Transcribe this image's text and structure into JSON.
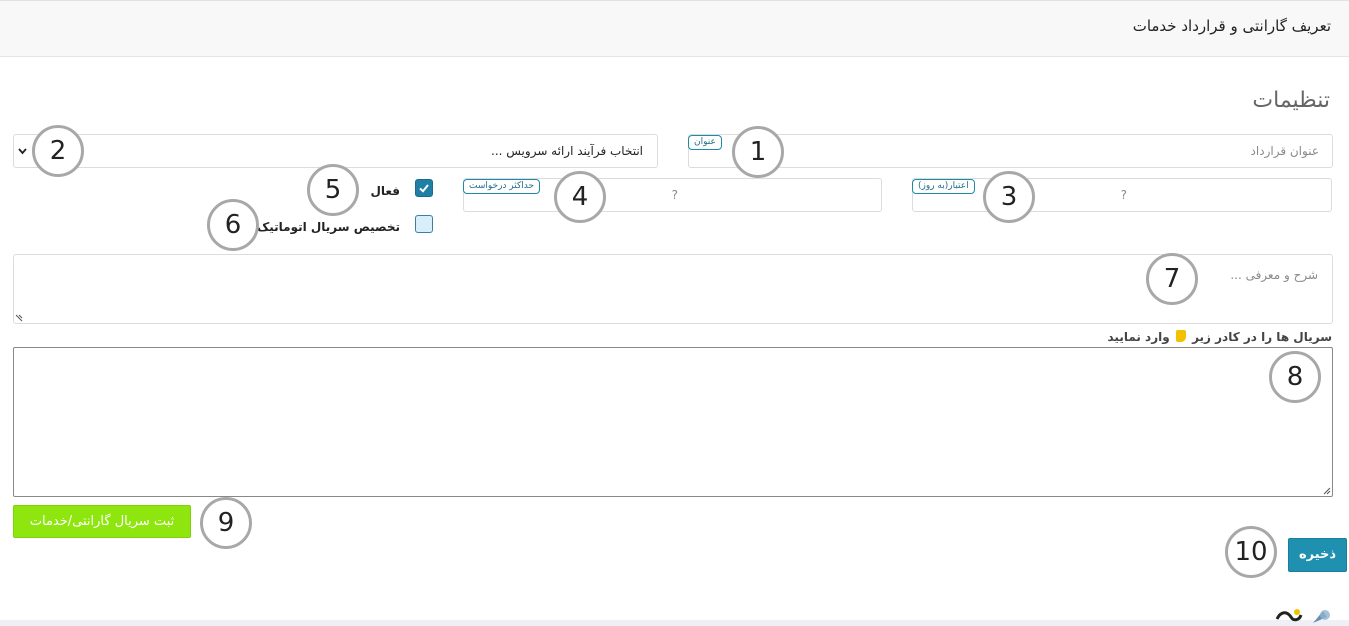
{
  "header": {
    "title": "تعریف گارانتی و قرارداد خدمات"
  },
  "section": {
    "title": "تنظیمات"
  },
  "form": {
    "contract_title": {
      "badge": "عنوان",
      "placeholder": "عنوان قرارداد"
    },
    "service_process": {
      "value": "انتخاب فرآیند ارائه سرویس ..."
    },
    "validity_days": {
      "badge": "اعتبار(به روز)",
      "placeholder": "?"
    },
    "max_requests": {
      "badge": "حداکثر درخواست",
      "placeholder": "?"
    },
    "active": {
      "label": "فعال",
      "checked": true
    },
    "auto_serial": {
      "label": "تخصیص سریال اتوماتیک",
      "checked": false
    },
    "description": {
      "placeholder": "شرح و معرفی ..."
    },
    "serials_hint": {
      "before": "سریال ها را در کادر زیر",
      "after": "وارد نمایید"
    }
  },
  "buttons": {
    "register_serial": "ثبت سریال گارانتی/خدمات",
    "save": "ذخیره"
  },
  "callouts": [
    "1",
    "2",
    "3",
    "4",
    "5",
    "6",
    "7",
    "8",
    "9",
    "10"
  ],
  "colors": {
    "primary": "#1f90b0",
    "success": "#8ee60e",
    "badge_border": "#1f8aa5",
    "checkbox_checked": "#1f7fa5"
  },
  "icons": {
    "dropdown": "chevron-down-icon",
    "check": "check-icon",
    "pointer": "pointing-hand-icon",
    "logo": "logo-icon"
  }
}
